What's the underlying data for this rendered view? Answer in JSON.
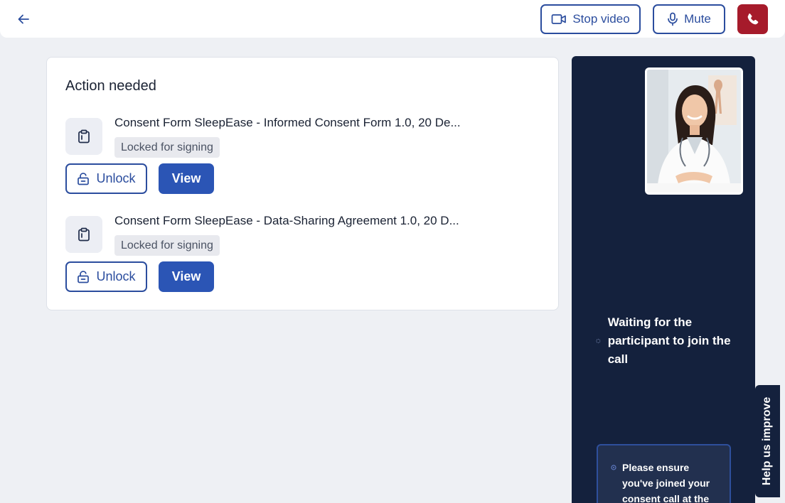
{
  "header": {
    "back_icon": "arrow-left-icon",
    "stop_video_label": "Stop video",
    "stop_video_icon": "video-camera-icon",
    "mute_label": "Mute",
    "mute_icon": "microphone-icon",
    "hangup_icon": "phone-icon",
    "colors": {
      "accent": "#2b4d9e",
      "hangup": "#a61b2b"
    }
  },
  "action_card": {
    "title": "Action needed",
    "documents": [
      {
        "title": "Consent Form SleepEase - Informed Consent Form 1.0, 20 De...",
        "status": "Locked for signing",
        "icon": "clipboard-icon",
        "unlock_label": "Unlock",
        "view_label": "View"
      },
      {
        "title": "Consent Form SleepEase - Data-Sharing Agreement 1.0, 20 D...",
        "status": "Locked for signing",
        "icon": "clipboard-icon",
        "unlock_label": "Unlock",
        "view_label": "View"
      }
    ]
  },
  "video_panel": {
    "self_view_image": "doctor-portrait",
    "waiting_text": "Waiting for the participant to join the call",
    "notice_text": "Please ensure you've joined your consent call at the",
    "colors": {
      "panel_bg": "#14213d"
    }
  },
  "help_tab": {
    "label": "Help us improve"
  }
}
